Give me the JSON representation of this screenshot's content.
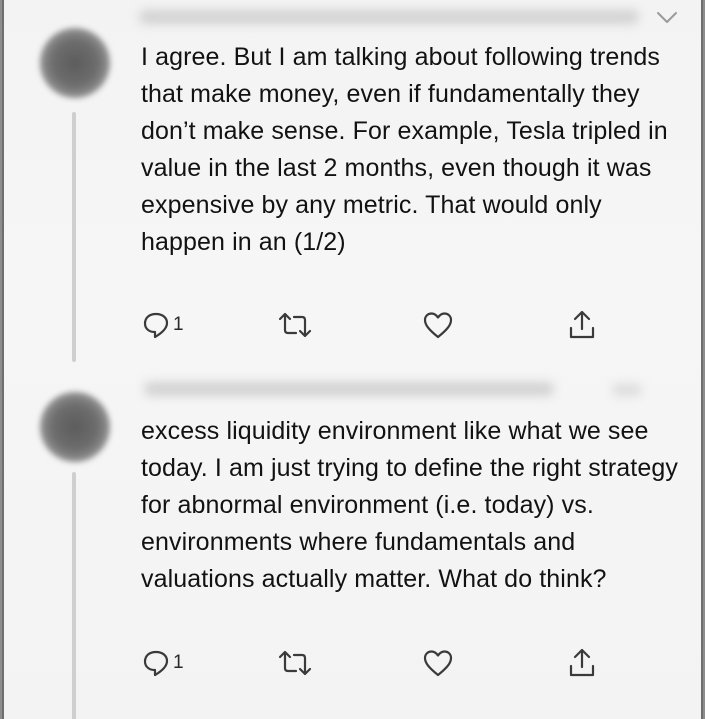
{
  "tweets": [
    {
      "text": "I agree. But I am talking about following trends that make money, even if fundamentally they don’t make sense. For example, Tesla tripled in value in the last 2 months, even though it was expensive by any metric.  That would only happen in an (1/2)",
      "reply_count": "1",
      "icons": [
        "reply-icon",
        "retweet-icon",
        "like-icon",
        "share-icon",
        "chevron-down-icon"
      ]
    },
    {
      "text": "excess liquidity environment like what we see today. I am just trying to define the right strategy for abnormal environment (i.e. today) vs. environments where fundamentals and valuations actually matter. What do think?",
      "reply_count": "1",
      "icons": [
        "reply-icon",
        "retweet-icon",
        "like-icon",
        "share-icon"
      ]
    }
  ],
  "colors": {
    "background": "#f3f3f3",
    "text": "#121212",
    "icon": "#3a3a3a",
    "thread_line": "#cfcfcf"
  }
}
